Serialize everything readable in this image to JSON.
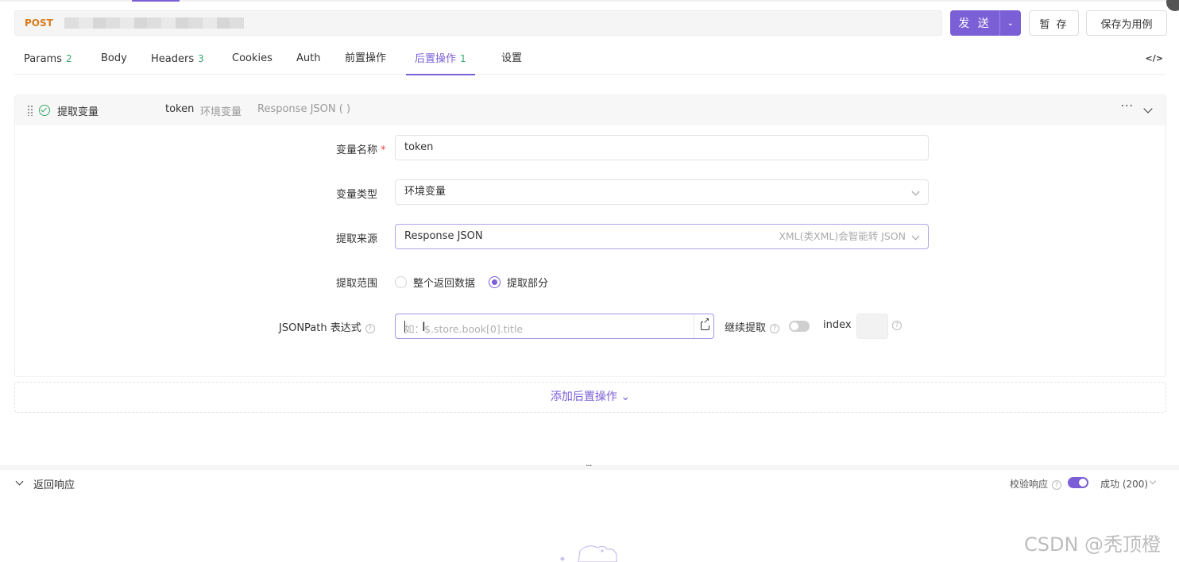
{
  "request": {
    "method": "POST",
    "send_label": "发 送",
    "save_label": "暂 存",
    "save_case_label": "保存为用例"
  },
  "tabs": [
    {
      "label": "Params",
      "count": "2"
    },
    {
      "label": "Body",
      "count": ""
    },
    {
      "label": "Headers",
      "count": "3"
    },
    {
      "label": "Cookies",
      "count": ""
    },
    {
      "label": "Auth",
      "count": ""
    },
    {
      "label": "前置操作",
      "count": ""
    },
    {
      "label": "后置操作",
      "count": "1"
    },
    {
      "label": "设置",
      "count": ""
    }
  ],
  "code_icon_label": "</>",
  "post_op": {
    "title": "提取变量",
    "summary_var": "token",
    "summary_type": "环境变量",
    "summary_source": "Response JSON ( )",
    "more_label": "···",
    "fields": {
      "var_name_label": "变量名称",
      "required_mark": "*",
      "var_name_value": "token",
      "var_type_label": "变量类型",
      "var_type_value": "环境变量",
      "source_label": "提取来源",
      "source_value": "Response JSON",
      "source_hint": "XML(类XML)会智能转 JSON",
      "scope_label": "提取范围",
      "scope_options": [
        "整个返回数据",
        "提取部分"
      ],
      "scope_selected": "提取部分",
      "jsonpath_label": "JSONPath 表达式",
      "jsonpath_placeholder": "如：$.store.book[0].title",
      "continue_label": "继续提取",
      "continue_enabled": false,
      "index_label": "index",
      "index_value": ""
    }
  },
  "add_post_label": "添加后置操作",
  "splitter_label": "···",
  "response": {
    "title": "返回响应",
    "verify_label": "校验响应",
    "verify_enabled": true,
    "status_label": "成功 (200)"
  },
  "watermark": "CSDN @秃顶橙",
  "colors": {
    "accent": "#7b5fd6",
    "method": "#d97a1a",
    "count": "#3aa76d"
  }
}
